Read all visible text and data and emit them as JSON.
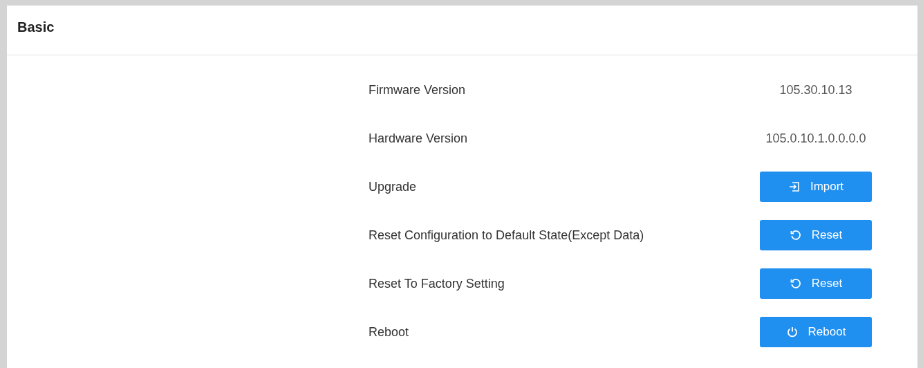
{
  "panel": {
    "title": "Basic"
  },
  "rows": [
    {
      "label": "Firmware Version",
      "kind": "text",
      "value": "105.30.10.13"
    },
    {
      "label": "Hardware Version",
      "kind": "text",
      "value": "105.0.10.1.0.0.0.0"
    },
    {
      "label": "Upgrade",
      "kind": "button",
      "button": {
        "label": "Import",
        "kind": "import"
      }
    },
    {
      "label": "Reset Configuration to Default State(Except Data)",
      "kind": "button",
      "button": {
        "label": "Reset",
        "kind": "reset"
      }
    },
    {
      "label": "Reset To Factory Setting",
      "kind": "button",
      "button": {
        "label": "Reset",
        "kind": "reset"
      }
    },
    {
      "label": "Reboot",
      "kind": "button",
      "button": {
        "label": "Reboot",
        "kind": "power"
      }
    }
  ]
}
